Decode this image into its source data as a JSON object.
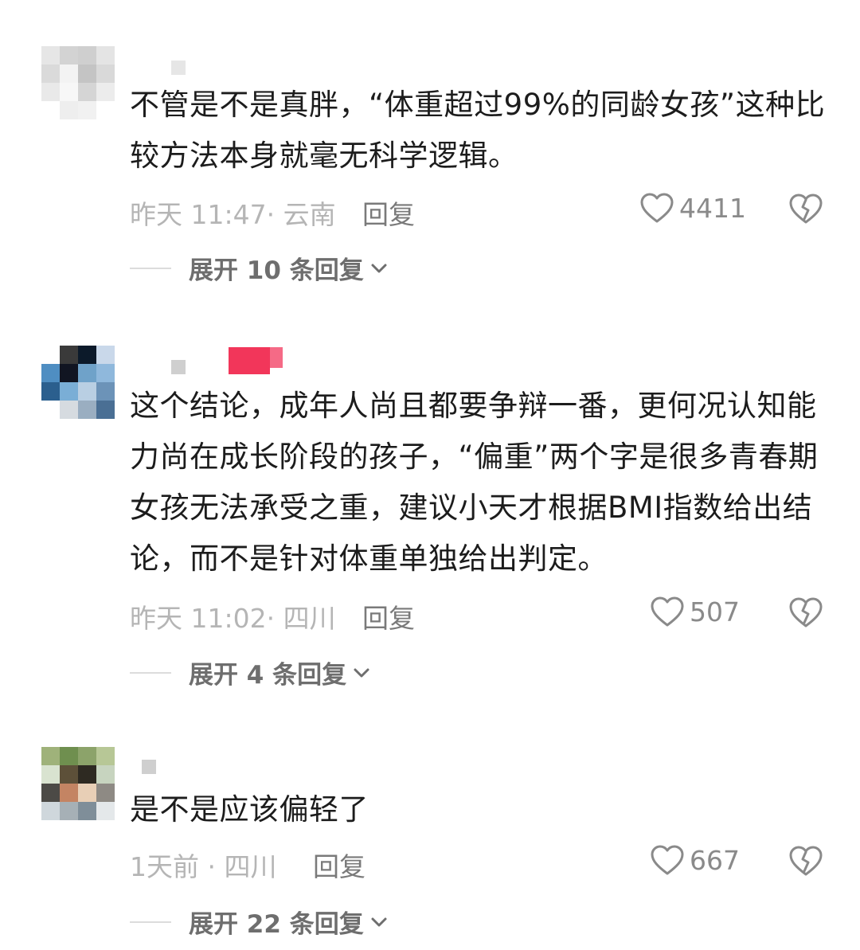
{
  "comments": [
    {
      "text": "不管是不是真胖，“体重超过99%的同龄女孩”这种比较方法本身就毫无科学逻辑。",
      "meta": "昨天 11:47· 云南",
      "reply_label": "回复",
      "likes": "4411",
      "expand_label": "展开 10 条回复"
    },
    {
      "text": "这个结论，成年人尚且都要争辩一番，更何况认知能力尚在成长阶段的孩子，“偏重”两个字是很多青春期女孩无法承受之重，建议小天才根据BMI指数给出结论，而不是针对体重单独给出判定。",
      "meta": "昨天 11:02· 四川",
      "reply_label": "回复",
      "likes": "507",
      "expand_label": "展开 4 条回复"
    },
    {
      "text": "是不是应该偏轻了",
      "meta": "1天前 · 四川",
      "reply_label": "回复",
      "likes": "667",
      "expand_label": "展开 22 条回复"
    }
  ],
  "icons": {
    "like": "heart-outline-icon",
    "dislike": "broken-heart-icon",
    "expand": "chevron-down-icon"
  },
  "colors": {
    "text": "#1c1c1c",
    "meta": "#b5b5b5",
    "reply": "#7a7a7a",
    "icon": "#8a8a8a",
    "badge": "#f2365a"
  }
}
